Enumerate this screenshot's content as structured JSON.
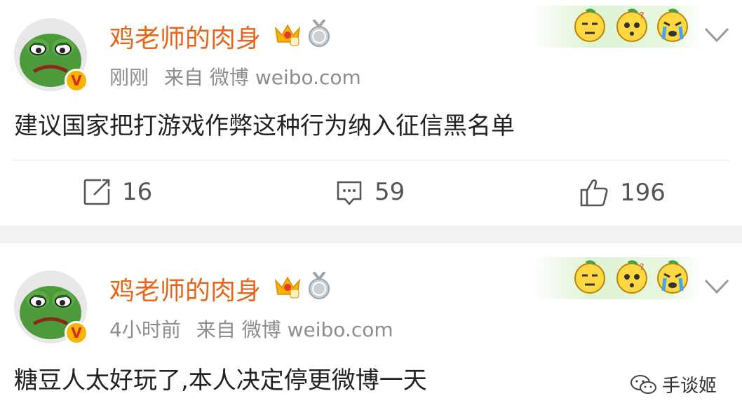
{
  "posts": [
    {
      "username": "鸡老师的肉身",
      "time": "刚刚",
      "source": "来自 微博 weibo.com",
      "content": "建议国家把打游戏作弊这种行为纳入征信黑名单",
      "actions": {
        "repost_count": "16",
        "comment_count": "59",
        "like_count": "196"
      }
    },
    {
      "username": "鸡老师的肉身",
      "time": "4小时前",
      "source": "来自 微博 weibo.com",
      "content": "糖豆人太好玩了,本人决定停更微博一天"
    }
  ],
  "watermark": {
    "label": "手谈姬"
  },
  "colors": {
    "username": "#e8661a",
    "meta": "#8d8d8d",
    "vip_badge": "#f7b500",
    "separator": "#f2f2f2"
  },
  "icons": [
    "avatar-frog",
    "crown-vip-icon",
    "medal-icon",
    "emoji-dizzy",
    "emoji-question",
    "emoji-crying",
    "chevron-down-icon",
    "repost-icon",
    "comment-icon",
    "like-icon",
    "wechat-icon"
  ]
}
